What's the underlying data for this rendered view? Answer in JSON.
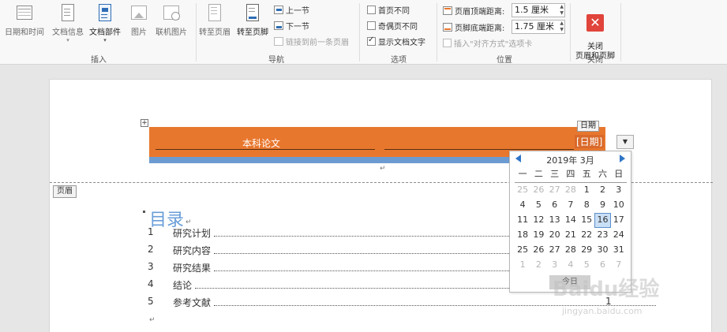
{
  "ribbon": {
    "insert_group": {
      "label": "插入",
      "buttons": [
        "日期和时间",
        "文档信息",
        "文档部件",
        "图片",
        "联机图片"
      ]
    },
    "nav_group": {
      "label": "导航",
      "goto_header": "转至页眉",
      "goto_footer": "转至页脚",
      "prev": "上一节",
      "next": "下一节",
      "link_prev": "链接到前一条页眉"
    },
    "options_group": {
      "label": "选项",
      "first_page": "首页不同",
      "odd_even": "奇偶页不同",
      "show_text": "显示文档文字"
    },
    "position_group": {
      "label": "位置",
      "header_top": "页眉顶端距离:",
      "header_top_value": "1.5 厘米",
      "footer_bottom": "页脚底端距离:",
      "footer_bottom_value": "1.75 厘米",
      "insert_align_tab": "插入\"对齐方式\"选项卡"
    },
    "close_group": {
      "label": "关闭",
      "close_button": "关闭\n页眉和页脚"
    }
  },
  "document": {
    "header_title": "本科论文",
    "date_placeholder": "[日期]",
    "date_control_tag": "日期",
    "header_label": "页眉",
    "toc_title": "目录",
    "toc": [
      {
        "num": "1",
        "text": "研究计划"
      },
      {
        "num": "2",
        "text": "研究内容"
      },
      {
        "num": "3",
        "text": "研究结果"
      },
      {
        "num": "4",
        "text": "结论"
      },
      {
        "num": "5",
        "text": "参考文献"
      }
    ],
    "last_page_num": "1"
  },
  "calendar": {
    "month_label": "2019年 3月",
    "weekdays": [
      "一",
      "二",
      "三",
      "四",
      "五",
      "六",
      "日"
    ],
    "weeks": [
      [
        "25",
        "26",
        "27",
        "28",
        "1",
        "2",
        "3"
      ],
      [
        "4",
        "5",
        "6",
        "7",
        "8",
        "9",
        "10"
      ],
      [
        "11",
        "12",
        "13",
        "14",
        "15",
        "16",
        "17"
      ],
      [
        "18",
        "19",
        "20",
        "21",
        "22",
        "23",
        "24"
      ],
      [
        "25",
        "26",
        "27",
        "28",
        "29",
        "30",
        "31"
      ],
      [
        "1",
        "2",
        "3",
        "4",
        "5",
        "6",
        "7"
      ]
    ],
    "selected_day": "16",
    "today_button": "今日"
  },
  "watermark": {
    "brand": "Baidu经验",
    "url": "jingyan.baidu.com"
  },
  "colors": {
    "header_orange": "#e8772e",
    "header_blue": "#6c9bd2",
    "toc_title": "#6a9ed8",
    "calendar_nav": "#2e75c6",
    "close_red": "#e0443a"
  }
}
